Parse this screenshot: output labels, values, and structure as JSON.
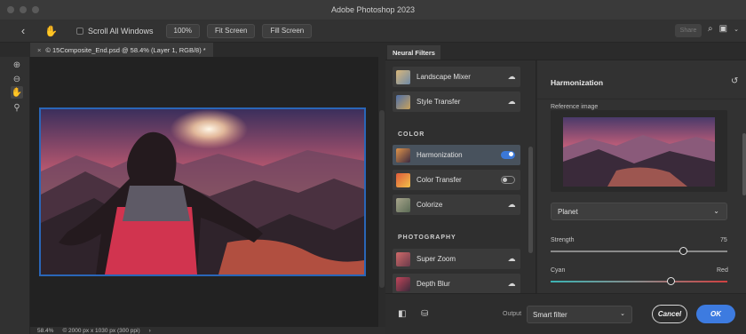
{
  "app": {
    "title": "Adobe Photoshop 2023"
  },
  "options_bar": {
    "scroll_all_windows": "Scroll All Windows",
    "zoom_100": "100%",
    "fit_screen": "Fit Screen",
    "fill_screen": "Fill Screen",
    "share": "Share"
  },
  "document": {
    "tab_title": "© 15Composite_End.psd @ 58.4% (Layer 1, RGB/8) *",
    "zoom": "58.4%",
    "dimensions": "© 2000 px x 1030 px (300 ppi)"
  },
  "neural_filters": {
    "panel_title": "Neural Filters",
    "sections": {
      "color": "COLOR",
      "photography": "PHOTOGRAPHY"
    },
    "items": [
      {
        "label": "Landscape Mixer",
        "state": "cloud"
      },
      {
        "label": "Style Transfer",
        "state": "cloud"
      },
      {
        "label": "Harmonization",
        "state": "on"
      },
      {
        "label": "Color Transfer",
        "state": "off"
      },
      {
        "label": "Colorize",
        "state": "cloud"
      },
      {
        "label": "Super Zoom",
        "state": "cloud"
      },
      {
        "label": "Depth Blur",
        "state": "cloud"
      }
    ]
  },
  "harmonization": {
    "title": "Harmonization",
    "reference_label": "Reference image",
    "layer_select": "Planet",
    "strength": {
      "label": "Strength",
      "value": "75",
      "fraction": 0.75
    },
    "cyan_red": {
      "left_label": "Cyan",
      "right_label": "Red",
      "fraction": 0.68
    }
  },
  "bottom": {
    "output_label": "Output",
    "output_value": "Smart filter",
    "cancel": "Cancel",
    "ok": "OK"
  },
  "colors": {
    "accent": "#3d7be0",
    "selection_border": "#2a66b8"
  }
}
